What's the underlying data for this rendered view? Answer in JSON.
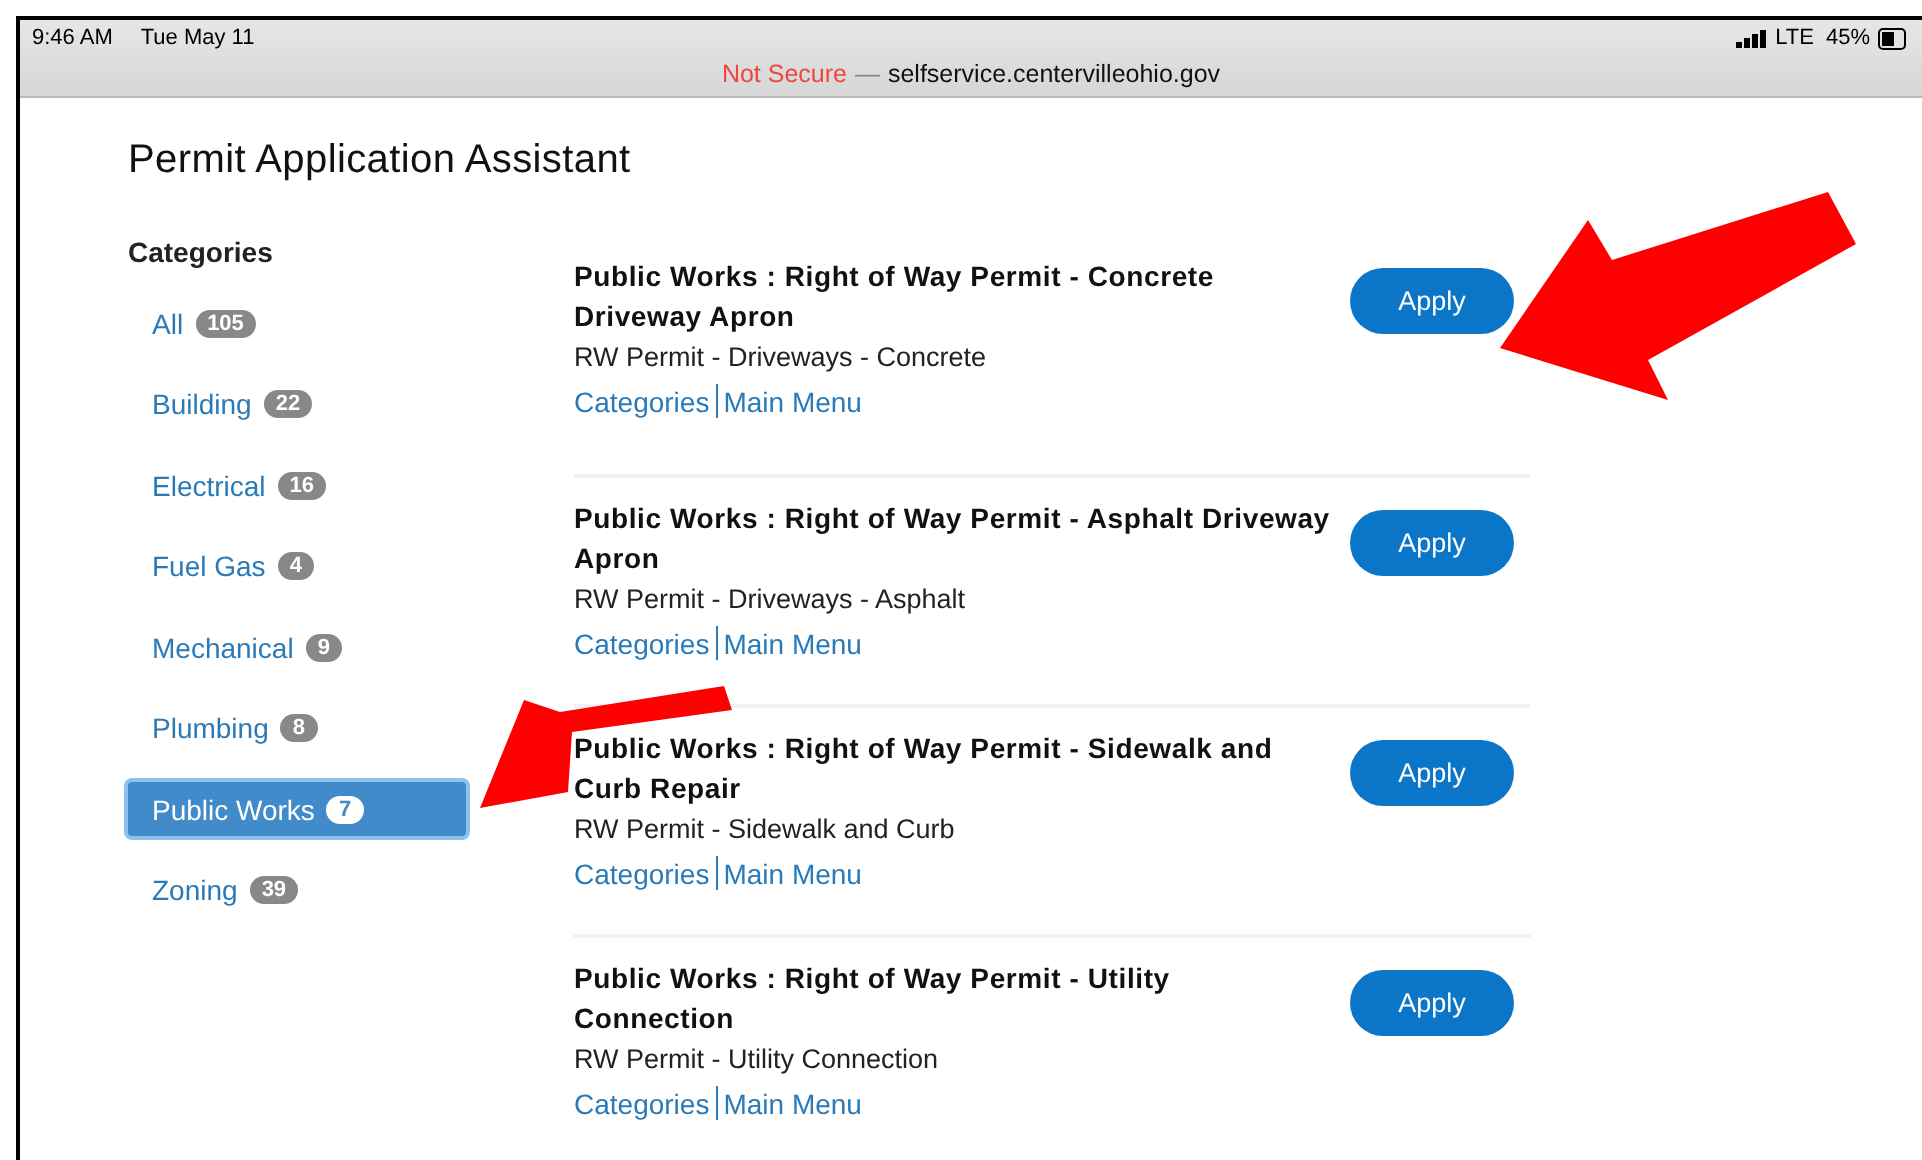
{
  "status_bar": {
    "time": "9:46 AM",
    "date": "Tue May 11",
    "network": "LTE",
    "battery": "45%"
  },
  "address_bar": {
    "security": "Not Secure",
    "separator": "—",
    "domain": "selfservice.centervilleohio.gov"
  },
  "page_title": "Permit Application Assistant",
  "sidebar": {
    "heading": "Categories",
    "items": [
      {
        "label": "All",
        "count": "105",
        "selected": false
      },
      {
        "label": "Building",
        "count": "22",
        "selected": false
      },
      {
        "label": "Electrical",
        "count": "16",
        "selected": false
      },
      {
        "label": "Fuel Gas",
        "count": "4",
        "selected": false
      },
      {
        "label": "Mechanical",
        "count": "9",
        "selected": false
      },
      {
        "label": "Plumbing",
        "count": "8",
        "selected": false
      },
      {
        "label": "Public Works",
        "count": "7",
        "selected": true
      },
      {
        "label": "Zoning",
        "count": "39",
        "selected": false
      }
    ]
  },
  "permits": [
    {
      "title": "Public Works : Right of Way Permit - Concrete Driveway Apron",
      "subtitle": "RW Permit - Driveways - Concrete",
      "links": [
        "Categories",
        "Main Menu"
      ],
      "button": "Apply"
    },
    {
      "title": "Public Works : Right of Way Permit - Asphalt Driveway Apron",
      "subtitle": "RW Permit - Driveways - Asphalt",
      "links": [
        "Categories",
        "Main Menu"
      ],
      "button": "Apply"
    },
    {
      "title": "Public Works : Right of Way Permit - Sidewalk and Curb Repair",
      "subtitle": "RW Permit - Sidewalk and Curb",
      "links": [
        "Categories",
        "Main Menu"
      ],
      "button": "Apply"
    },
    {
      "title": "Public Works : Right of Way Permit - Utility Connection",
      "subtitle": "RW Permit - Utility Connection",
      "links": [
        "Categories",
        "Main Menu"
      ],
      "button": "Apply"
    }
  ]
}
